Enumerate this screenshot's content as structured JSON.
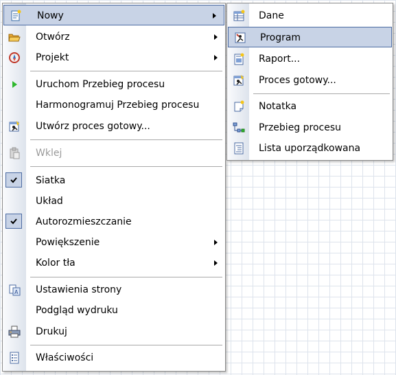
{
  "main_menu": {
    "items": [
      {
        "label": "Nowy",
        "icon": "new-document-icon",
        "submenu": true,
        "highlighted": true
      },
      {
        "label": "Otwórz",
        "icon": "open-folder-icon",
        "submenu": true
      },
      {
        "label": "Projekt",
        "icon": "project-compass-icon",
        "submenu": true
      },
      {
        "label": "Uruchom Przebieg procesu",
        "icon": "play-icon"
      },
      {
        "label": "Harmonogramuj Przebieg procesu",
        "icon": ""
      },
      {
        "label": "Utwórz proces gotowy...",
        "icon": "create-ready-process-icon"
      },
      {
        "label": "Wklej",
        "icon": "paste-icon",
        "disabled": true
      },
      {
        "label": "Siatka",
        "icon": "",
        "checked": true
      },
      {
        "label": "Układ",
        "icon": ""
      },
      {
        "label": "Autorozmieszczanie",
        "icon": "",
        "checked": true
      },
      {
        "label": "Powiększenie",
        "icon": "",
        "submenu": true
      },
      {
        "label": "Kolor tła",
        "icon": "",
        "submenu": true
      },
      {
        "label": "Ustawienia strony",
        "icon": "page-setup-icon"
      },
      {
        "label": "Podgląd wydruku",
        "icon": ""
      },
      {
        "label": "Drukuj",
        "icon": "printer-icon"
      },
      {
        "label": "Właściwości",
        "icon": "properties-icon"
      }
    ]
  },
  "sub_menu": {
    "items": [
      {
        "label": "Dane",
        "icon": "data-table-icon"
      },
      {
        "label": "Program",
        "icon": "program-icon",
        "highlighted": true
      },
      {
        "label": "Raport...",
        "icon": "report-icon"
      },
      {
        "label": "Proces gotowy...",
        "icon": "ready-process-icon"
      },
      {
        "label": "Notatka",
        "icon": "note-icon"
      },
      {
        "label": "Przebieg procesu",
        "icon": "process-flow-icon"
      },
      {
        "label": "Lista uporządkowana",
        "icon": "ordered-list-icon"
      }
    ]
  },
  "colors": {
    "highlight_fill": "#c8d3e6",
    "highlight_border": "#4a6aa2",
    "disabled_text": "#9a9a9a",
    "grid_line": "#dde3ec"
  }
}
